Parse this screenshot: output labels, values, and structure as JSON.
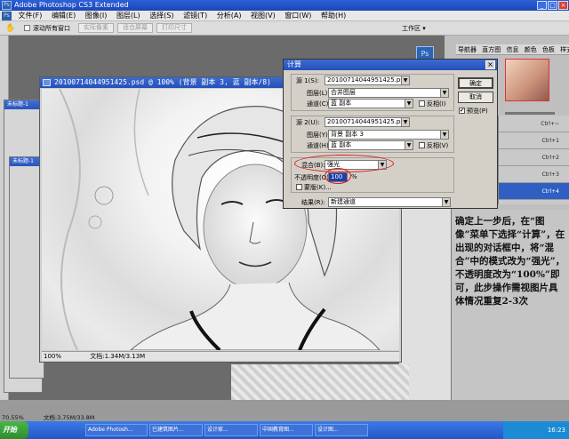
{
  "app": {
    "title": "Adobe Photoshop CS3 Extended",
    "logo": "Ps"
  },
  "menu": [
    "文件(F)",
    "编辑(E)",
    "图像(I)",
    "图层(L)",
    "选择(S)",
    "滤镜(T)",
    "分析(A)",
    "视图(V)",
    "窗口(W)",
    "帮助(H)"
  ],
  "options": {
    "scroll_all_label": "滚动所有窗口",
    "actual_pixels": "实际像素",
    "fit_screen": "适合屏幕",
    "print_size": "打印尺寸",
    "workspace": "工作区 ▾"
  },
  "panels": {
    "nav_tabs": [
      "导航器",
      "直方图",
      "信息",
      "颜色",
      "色板",
      "样式"
    ],
    "history_shortcuts": [
      "Ctrl+~",
      "Ctrl+1",
      "Ctrl+2",
      "Ctrl+3",
      "Ctrl+4"
    ]
  },
  "background_windows": {
    "win1_title": "未标题-1",
    "win2_title": "未标题-1"
  },
  "document": {
    "title": "20100714044951425.psd @ 100% (背景 副本 3, 蓝 副本/8)",
    "zoom": "100%",
    "doc_info": "文档:1.34M/3.13M"
  },
  "dialog": {
    "title": "计算",
    "source1": {
      "label": "源 1(S):",
      "file": "20100714044951425.psd",
      "layer_label": "图层(L):",
      "layer": "合并图层",
      "channel_label": "通道(C):",
      "channel": "蓝 副本",
      "invert": "反相(I)"
    },
    "source2": {
      "label": "源 2(U):",
      "file": "20100714044951425.psd",
      "layer_label": "图层(Y):",
      "layer": "背景 副本 3",
      "channel_label": "通道(H):",
      "channel": "蓝 副本",
      "invert": "反相(V)"
    },
    "blend_label": "混合(B):",
    "blend": "强光",
    "opacity_label": "不透明度(O):",
    "opacity": "100",
    "opacity_unit": "%",
    "mask_label": "蒙版(K)...",
    "result_label": "结果(R):",
    "result": "新建通道",
    "ok": "确定",
    "cancel": "取消",
    "preview": "预览(P)",
    "preview_checked": "✔"
  },
  "annotation": "确定上一步后，在“图像”菜单下选择“计算”，在出现的对话框中，将“混合”中的模式改为“强光”，不透明度改为“100%”即可，此步操作需视图片具体情况重复2-3次",
  "status": {
    "zoom": "70.55%",
    "doc_info": "文档:3.75M/33.8M"
  },
  "taskbar": {
    "start": "开始",
    "items": [
      "Adobe Photosh...",
      "已建筑图片...",
      "设计家...",
      "中国教育图...",
      "设计图..."
    ],
    "tray": "16:23"
  }
}
